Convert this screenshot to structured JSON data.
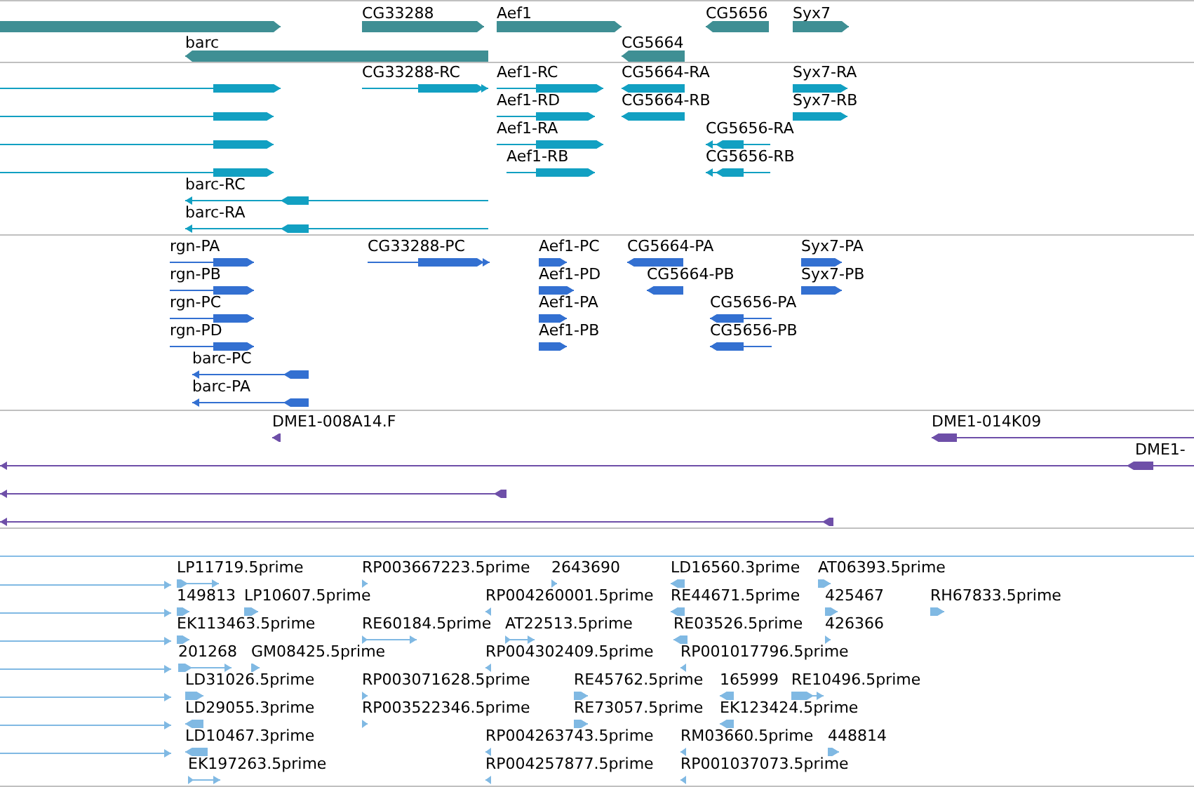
{
  "tracks": [
    {
      "kind": "gene",
      "features": [
        {
          "reverse": false
        },
        {
          "label": "CG33288",
          "reverse": false
        },
        {
          "label": "Aef1",
          "reverse": false
        },
        {
          "label": "CG5656",
          "reverse": true
        },
        {
          "label": "Syx7",
          "reverse": false
        },
        {
          "label": "barc",
          "reverse": true
        },
        {
          "label": "CG5664",
          "reverse": true
        }
      ]
    },
    {
      "kind": "transcript",
      "features": [
        {
          "reverse": false
        },
        {
          "reverse": false
        },
        {
          "reverse": false
        },
        {
          "reverse": false
        },
        {
          "label": "CG33288-RC",
          "reverse": false
        },
        {
          "label": "Aef1-RC",
          "reverse": false
        },
        {
          "label": "Aef1-RD",
          "reverse": false
        },
        {
          "label": "Aef1-RA",
          "reverse": false
        },
        {
          "label": "Aef1-RB",
          "reverse": false
        },
        {
          "label": "CG5664-RA",
          "reverse": true
        },
        {
          "label": "CG5664-RB",
          "reverse": true
        },
        {
          "label": "Syx7-RA",
          "reverse": false
        },
        {
          "label": "Syx7-RB",
          "reverse": false
        },
        {
          "label": "CG5656-RA",
          "reverse": true
        },
        {
          "label": "CG5656-RB",
          "reverse": true
        },
        {
          "label": "barc-RC",
          "reverse": true
        },
        {
          "label": "barc-RA",
          "reverse": true
        }
      ]
    },
    {
      "kind": "protein",
      "features": [
        {
          "label": "rgn-PA",
          "reverse": false
        },
        {
          "label": "rgn-PB",
          "reverse": false
        },
        {
          "label": "rgn-PC",
          "reverse": false
        },
        {
          "label": "rgn-PD",
          "reverse": false
        },
        {
          "label": "barc-PC",
          "reverse": true
        },
        {
          "label": "barc-PA",
          "reverse": true
        },
        {
          "label": "CG33288-PC",
          "reverse": false
        },
        {
          "label": "Aef1-PC",
          "reverse": false
        },
        {
          "label": "Aef1-PD",
          "reverse": false
        },
        {
          "label": "Aef1-PA",
          "reverse": false
        },
        {
          "label": "Aef1-PB",
          "reverse": false
        },
        {
          "label": "CG5664-PA",
          "reverse": true
        },
        {
          "label": "CG5664-PB",
          "reverse": true
        },
        {
          "label": "CG5656-PA",
          "reverse": true
        },
        {
          "label": "CG5656-PB",
          "reverse": true
        },
        {
          "label": "Syx7-PA",
          "reverse": false
        },
        {
          "label": "Syx7-PB",
          "reverse": false
        }
      ]
    },
    {
      "kind": "clone",
      "features": [
        {
          "label": "DME1-008A14.F",
          "reverse": true
        },
        {
          "label": "DME1-014K09",
          "reverse": true
        },
        {
          "label": "DME1-",
          "reverse": true
        },
        {
          "reverse": true
        },
        {
          "reverse": true
        }
      ]
    },
    {
      "kind": "est",
      "features": [
        {
          "reverse": false
        },
        {
          "reverse": false
        },
        {
          "reverse": false
        },
        {
          "reverse": false
        },
        {
          "reverse": false
        },
        {
          "reverse": false
        },
        {
          "reverse": false
        },
        {
          "label": "LP11719.5prime",
          "reverse": false
        },
        {
          "label": "RP003667223.5prime",
          "reverse": false
        },
        {
          "label": "2643690",
          "reverse": false
        },
        {
          "label": "LD16560.3prime",
          "reverse": true
        },
        {
          "label": "AT06393.5prime",
          "reverse": false
        },
        {
          "label": "149813",
          "reverse": false
        },
        {
          "label": "LP10607.5prime",
          "reverse": false
        },
        {
          "label": "RP004260001.5prime",
          "reverse": true
        },
        {
          "label": "RE44671.5prime",
          "reverse": true
        },
        {
          "label": "425467",
          "reverse": false
        },
        {
          "label": "RH67833.5prime",
          "reverse": false
        },
        {
          "label": "EK113463.5prime",
          "reverse": false
        },
        {
          "label": "RE60184.5prime",
          "reverse": false
        },
        {
          "label": "AT22513.5prime",
          "reverse": false
        },
        {
          "label": "RE03526.5prime",
          "reverse": true
        },
        {
          "label": "426366",
          "reverse": false
        },
        {
          "label": "201268",
          "reverse": false
        },
        {
          "label": "GM08425.5prime",
          "reverse": false
        },
        {
          "label": "RP004302409.5prime",
          "reverse": true
        },
        {
          "label": "RP001017796.5prime",
          "reverse": true
        },
        {
          "label": "LD31026.5prime",
          "reverse": false
        },
        {
          "label": "RP003071628.5prime",
          "reverse": false
        },
        {
          "label": "RE45762.5prime",
          "reverse": false
        },
        {
          "label": "165999",
          "reverse": true
        },
        {
          "label": "RE10496.5prime",
          "reverse": false
        },
        {
          "label": "LD29055.3prime",
          "reverse": true
        },
        {
          "label": "RP003522346.5prime",
          "reverse": false
        },
        {
          "label": "RE73057.5prime",
          "reverse": false
        },
        {
          "label": "EK123424.5prime",
          "reverse": true
        },
        {
          "label": "LD10467.3prime",
          "reverse": true
        },
        {
          "label": "RP004263743.5prime",
          "reverse": true
        },
        {
          "label": "RM03660.5prime",
          "reverse": true
        },
        {
          "label": "448814",
          "reverse": false
        },
        {
          "label": "EK197263.5prime",
          "reverse": false
        },
        {
          "label": "RP004257877.5prime",
          "reverse": true
        },
        {
          "label": "RP001037073.5prime",
          "reverse": true
        }
      ]
    }
  ]
}
